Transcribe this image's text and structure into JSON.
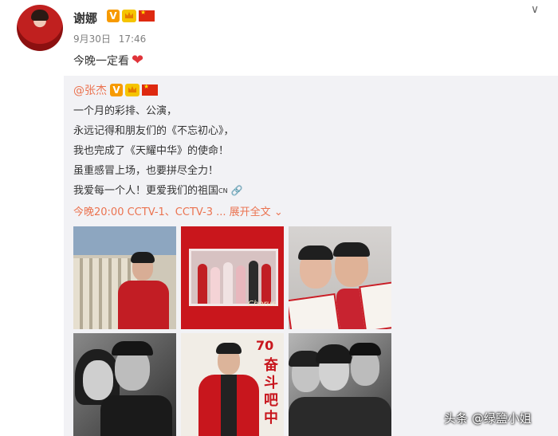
{
  "post": {
    "username": "谢娜",
    "date": "9月30日",
    "time": "17:46",
    "text": "今晚一定看",
    "heart_icon": "heart-icon",
    "menu_icon": "chevron-down-icon"
  },
  "repost": {
    "user": "@张杰",
    "lines": [
      "一个月的彩排、公演，",
      "永远记得和朋友们的《不忘初心》，",
      "我也完成了《天耀中华》的使命！",
      "虽重感冒上场，也要拼尽全力！",
      "我爱每一个人！更爱我们的祖国"
    ],
    "link_badge": "CN",
    "preview": "今晚20:00 CCTV-1、CCTV-3 ...",
    "expand_label": "展开全文",
    "images": [
      {
        "name": "portrait-red-jacket"
      },
      {
        "name": "group-photo-red"
      },
      {
        "name": "selfie-certificates"
      },
      {
        "name": "bw-selfie-duo"
      },
      {
        "name": "poster-70th"
      },
      {
        "name": "bw-group-selfie"
      }
    ],
    "poster_number": "70",
    "poster_vertical_text": "奋斗吧中"
  },
  "watermark": "头条 @绿鹽小姐",
  "colors": {
    "accent": "#eb7350",
    "verified": "#f79a00",
    "heart": "#e0343a",
    "repost_bg": "#f2f2f5"
  }
}
